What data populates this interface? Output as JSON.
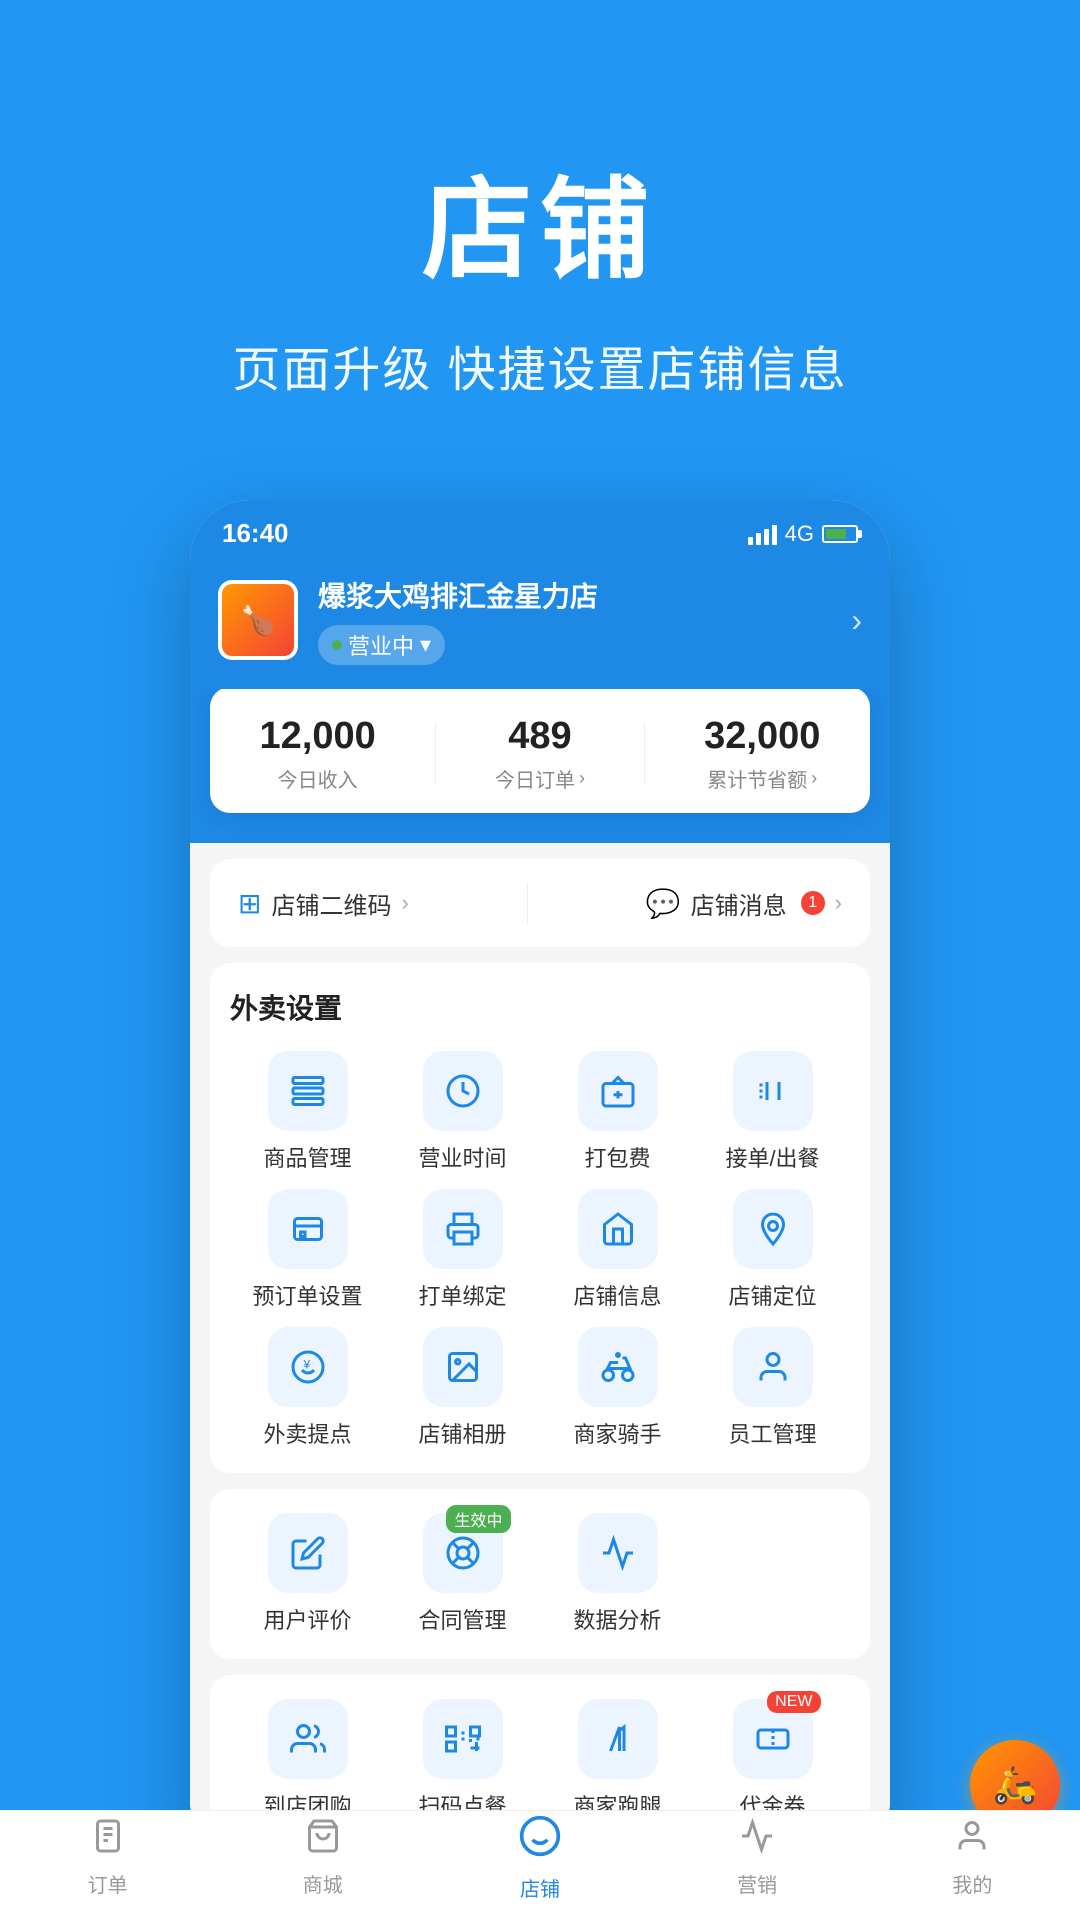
{
  "hero": {
    "title": "店铺",
    "subtitle": "页面升级 快捷设置店铺信息"
  },
  "status_bar": {
    "time": "16:40",
    "network": "4G"
  },
  "store": {
    "name": "爆浆大鸡排汇金星力店",
    "status": "营业中"
  },
  "stats": {
    "daily_income": "12,000",
    "daily_income_label": "今日收入",
    "daily_orders": "489",
    "daily_orders_label": "今日订单",
    "total_savings": "32,000",
    "total_savings_label": "累计节省额"
  },
  "quick_links": {
    "qrcode_label": "店铺二维码",
    "message_label": "店铺消息",
    "message_badge": "1"
  },
  "takeaway_section": {
    "title": "外卖设置",
    "items": [
      {
        "label": "商品管理",
        "icon": "layers"
      },
      {
        "label": "营业时间",
        "icon": "clock"
      },
      {
        "label": "打包费",
        "icon": "briefcase"
      },
      {
        "label": "接单/出餐",
        "icon": "fork-knife"
      },
      {
        "label": "预订单设置",
        "icon": "wallet"
      },
      {
        "label": "打单绑定",
        "icon": "printer"
      },
      {
        "label": "店铺信息",
        "icon": "store-info"
      },
      {
        "label": "店铺定位",
        "icon": "location"
      },
      {
        "label": "外卖提点",
        "icon": "percent"
      },
      {
        "label": "店铺相册",
        "icon": "photo"
      },
      {
        "label": "商家骑手",
        "icon": "rider"
      },
      {
        "label": "员工管理",
        "icon": "staff"
      }
    ]
  },
  "management_section": {
    "items": [
      {
        "label": "用户评价",
        "icon": "review",
        "badge": null
      },
      {
        "label": "合同管理",
        "icon": "contract",
        "badge": "生效中"
      },
      {
        "label": "数据分析",
        "icon": "chart",
        "badge": null
      }
    ]
  },
  "promo_section": {
    "items": [
      {
        "label": "到店团购",
        "icon": "group"
      },
      {
        "label": "扫码点餐",
        "icon": "scan"
      },
      {
        "label": "商家跑腿",
        "icon": "run"
      },
      {
        "label": "代金券",
        "icon": "coupon",
        "badge": "NEW"
      }
    ]
  },
  "tabs": [
    {
      "label": "订单",
      "icon": "order",
      "active": false
    },
    {
      "label": "商城",
      "icon": "shop",
      "active": false
    },
    {
      "label": "店铺",
      "icon": "store",
      "active": true
    },
    {
      "label": "营销",
      "icon": "marketing",
      "active": false
    },
    {
      "label": "我的",
      "icon": "profile",
      "active": false
    }
  ]
}
